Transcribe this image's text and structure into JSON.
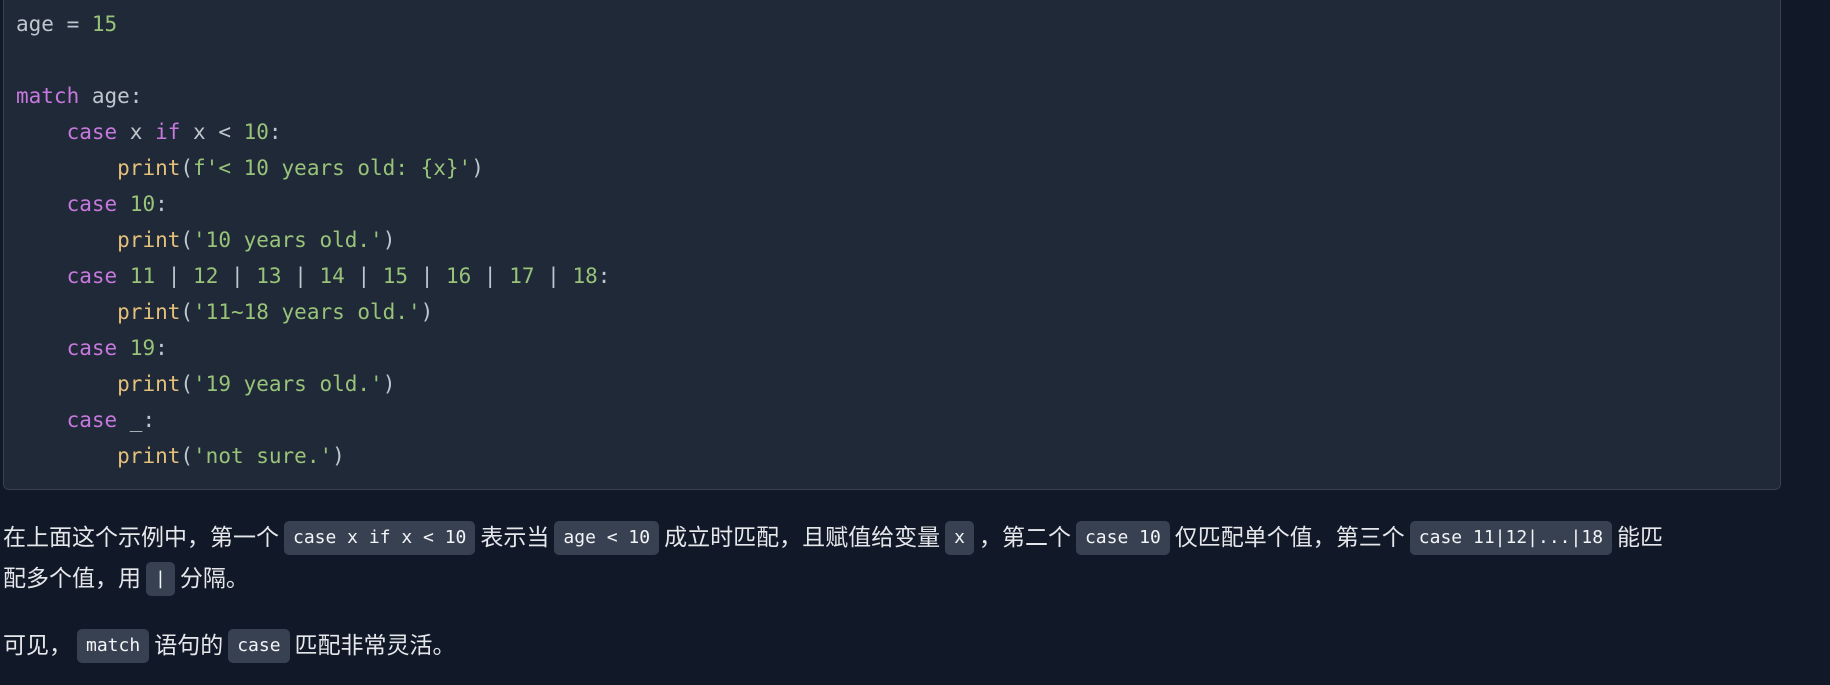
{
  "code": {
    "lines": [
      [
        {
          "t": "age",
          "c": "ident"
        },
        {
          "t": " = ",
          "c": "op"
        },
        {
          "t": "15",
          "c": "num"
        }
      ],
      [],
      [
        {
          "t": "match",
          "c": "kw"
        },
        {
          "t": " age:",
          "c": "ident"
        }
      ],
      [
        {
          "t": "    ",
          "c": "op"
        },
        {
          "t": "case",
          "c": "kw"
        },
        {
          "t": " x ",
          "c": "ident"
        },
        {
          "t": "if",
          "c": "kw"
        },
        {
          "t": " x < ",
          "c": "ident"
        },
        {
          "t": "10",
          "c": "num"
        },
        {
          "t": ":",
          "c": "op"
        }
      ],
      [
        {
          "t": "        ",
          "c": "op"
        },
        {
          "t": "print",
          "c": "fn"
        },
        {
          "t": "(",
          "c": "op"
        },
        {
          "t": "f'< 10 years old: {x}'",
          "c": "str"
        },
        {
          "t": ")",
          "c": "op"
        }
      ],
      [
        {
          "t": "    ",
          "c": "op"
        },
        {
          "t": "case",
          "c": "kw"
        },
        {
          "t": " ",
          "c": "op"
        },
        {
          "t": "10",
          "c": "num"
        },
        {
          "t": ":",
          "c": "op"
        }
      ],
      [
        {
          "t": "        ",
          "c": "op"
        },
        {
          "t": "print",
          "c": "fn"
        },
        {
          "t": "(",
          "c": "op"
        },
        {
          "t": "'10 years old.'",
          "c": "str"
        },
        {
          "t": ")",
          "c": "op"
        }
      ],
      [
        {
          "t": "    ",
          "c": "op"
        },
        {
          "t": "case",
          "c": "kw"
        },
        {
          "t": " ",
          "c": "op"
        },
        {
          "t": "11",
          "c": "num"
        },
        {
          "t": " | ",
          "c": "op"
        },
        {
          "t": "12",
          "c": "num"
        },
        {
          "t": " | ",
          "c": "op"
        },
        {
          "t": "13",
          "c": "num"
        },
        {
          "t": " | ",
          "c": "op"
        },
        {
          "t": "14",
          "c": "num"
        },
        {
          "t": " | ",
          "c": "op"
        },
        {
          "t": "15",
          "c": "num"
        },
        {
          "t": " | ",
          "c": "op"
        },
        {
          "t": "16",
          "c": "num"
        },
        {
          "t": " | ",
          "c": "op"
        },
        {
          "t": "17",
          "c": "num"
        },
        {
          "t": " | ",
          "c": "op"
        },
        {
          "t": "18",
          "c": "num"
        },
        {
          "t": ":",
          "c": "op"
        }
      ],
      [
        {
          "t": "        ",
          "c": "op"
        },
        {
          "t": "print",
          "c": "fn"
        },
        {
          "t": "(",
          "c": "op"
        },
        {
          "t": "'11~18 years old.'",
          "c": "str"
        },
        {
          "t": ")",
          "c": "op"
        }
      ],
      [
        {
          "t": "    ",
          "c": "op"
        },
        {
          "t": "case",
          "c": "kw"
        },
        {
          "t": " ",
          "c": "op"
        },
        {
          "t": "19",
          "c": "num"
        },
        {
          "t": ":",
          "c": "op"
        }
      ],
      [
        {
          "t": "        ",
          "c": "op"
        },
        {
          "t": "print",
          "c": "fn"
        },
        {
          "t": "(",
          "c": "op"
        },
        {
          "t": "'19 years old.'",
          "c": "str"
        },
        {
          "t": ")",
          "c": "op"
        }
      ],
      [
        {
          "t": "    ",
          "c": "op"
        },
        {
          "t": "case",
          "c": "kw"
        },
        {
          "t": " _:",
          "c": "ident"
        }
      ],
      [
        {
          "t": "        ",
          "c": "op"
        },
        {
          "t": "print",
          "c": "fn"
        },
        {
          "t": "(",
          "c": "op"
        },
        {
          "t": "'not sure.'",
          "c": "str"
        },
        {
          "t": ")",
          "c": "op"
        }
      ]
    ]
  },
  "text": {
    "p1": [
      {
        "type": "text",
        "v": "在上面这个示例中，第一个"
      },
      {
        "type": "code",
        "v": "case x if x < 10"
      },
      {
        "type": "text",
        "v": "表示当"
      },
      {
        "type": "code",
        "v": "age < 10"
      },
      {
        "type": "text",
        "v": "成立时匹配，且赋值给变量"
      },
      {
        "type": "code",
        "v": "x"
      },
      {
        "type": "text",
        "v": "，第二个"
      },
      {
        "type": "code",
        "v": "case 10"
      },
      {
        "type": "text",
        "v": "仅匹配单个值，第三个"
      },
      {
        "type": "code",
        "v": "case 11|12|...|18"
      },
      {
        "type": "text",
        "v": "能匹"
      }
    ],
    "p2": [
      {
        "type": "text",
        "v": "配多个值，用"
      },
      {
        "type": "code",
        "v": "|"
      },
      {
        "type": "text",
        "v": "分隔。"
      }
    ],
    "p3": [
      {
        "type": "text",
        "v": "可见，"
      },
      {
        "type": "code",
        "v": "match"
      },
      {
        "type": "text",
        "v": "语句的"
      },
      {
        "type": "code",
        "v": "case"
      },
      {
        "type": "text",
        "v": "匹配非常灵活。"
      }
    ]
  }
}
